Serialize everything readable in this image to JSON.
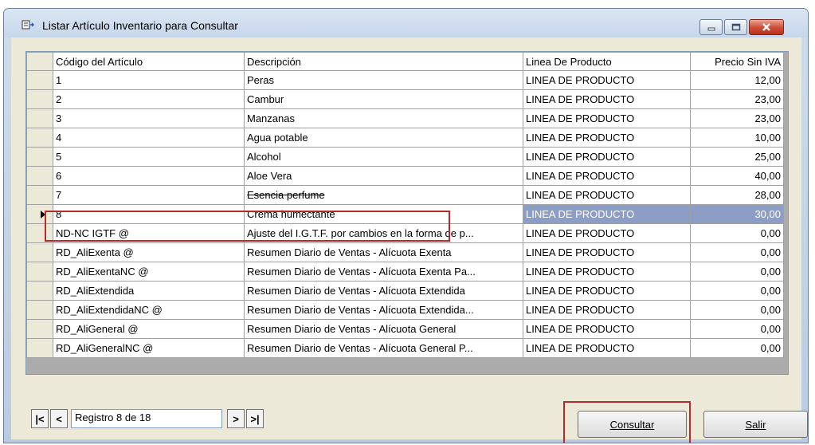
{
  "window": {
    "title": "Listar Artículo Inventario para Consultar"
  },
  "grid": {
    "columns": [
      "Código del Artículo",
      "Descripción",
      "Linea De Producto",
      "Precio Sin IVA"
    ],
    "rows": [
      {
        "code": "1",
        "desc": "Peras",
        "line": "LINEA DE PRODUCTO",
        "price": "12,00"
      },
      {
        "code": "2",
        "desc": "Cambur",
        "line": "LINEA DE PRODUCTO",
        "price": "23,00"
      },
      {
        "code": "3",
        "desc": "Manzanas",
        "line": "LINEA DE PRODUCTO",
        "price": "23,00"
      },
      {
        "code": "4",
        "desc": "Agua potable",
        "line": "LINEA DE PRODUCTO",
        "price": "10,00"
      },
      {
        "code": "5",
        "desc": "Alcohol",
        "line": "LINEA DE PRODUCTO",
        "price": "25,00"
      },
      {
        "code": "6",
        "desc": "Aloe Vera",
        "line": "LINEA DE PRODUCTO",
        "price": "40,00"
      },
      {
        "code": "7",
        "desc": "Esencia perfume",
        "line": "LINEA DE PRODUCTO",
        "price": "28,00"
      },
      {
        "code": "8",
        "desc": "Crema humectante",
        "line": "LINEA DE PRODUCTO",
        "price": "30,00"
      },
      {
        "code": "ND-NC IGTF @",
        "desc": "Ajuste del I.G.T.F. por cambios en la forma de p...",
        "line": "LINEA DE PRODUCTO",
        "price": "0,00"
      },
      {
        "code": "RD_AliExenta  @",
        "desc": "Resumen Diario de Ventas - Alícuota Exenta",
        "line": "LINEA DE PRODUCTO",
        "price": "0,00"
      },
      {
        "code": "RD_AliExentaNC @",
        "desc": "Resumen Diario de Ventas - Alícuota Exenta Pa...",
        "line": "LINEA DE PRODUCTO",
        "price": "0,00"
      },
      {
        "code": "RD_AliExtendida",
        "desc": "Resumen Diario de Ventas - Alícuota Extendida",
        "line": "LINEA DE PRODUCTO",
        "price": "0,00"
      },
      {
        "code": "RD_AliExtendidaNC @",
        "desc": "Resumen Diario de Ventas - Alícuota Extendida...",
        "line": "LINEA DE PRODUCTO",
        "price": "0,00"
      },
      {
        "code": "RD_AliGeneral @",
        "desc": "Resumen Diario de Ventas - Alícuota General",
        "line": "LINEA DE PRODUCTO",
        "price": "0,00"
      },
      {
        "code": "RD_AliGeneralNC @",
        "desc": "Resumen Diario de Ventas - Alícuota General P...",
        "line": "LINEA DE PRODUCTO",
        "price": "0,00"
      }
    ],
    "selected_row": 8
  },
  "navigator": {
    "first": "|<",
    "prev": "<",
    "next": ">",
    "last": ">|",
    "position": "Registro 8 de 18"
  },
  "buttons": {
    "consultar": "Consultar",
    "salir": "Salir"
  },
  "colors": {
    "selection": "#8c9ec5",
    "highlight_box": "#b52b2b"
  }
}
